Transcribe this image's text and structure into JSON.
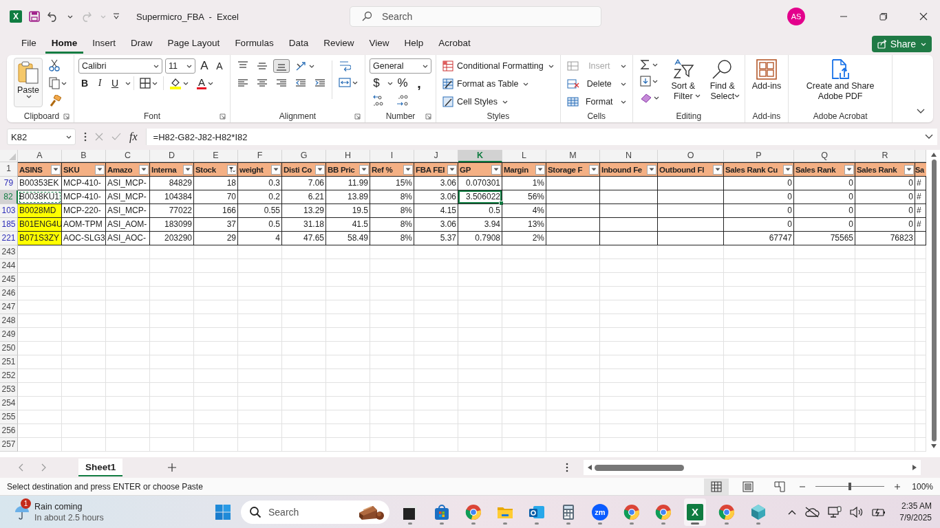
{
  "title_bar": {
    "app_letter": "X",
    "title": "Supermicro_FBA  -  Excel",
    "search_placeholder": "Search",
    "avatar": "AS"
  },
  "menu_tabs": [
    {
      "label": "File",
      "selected": false
    },
    {
      "label": "Home",
      "selected": true
    },
    {
      "label": "Insert",
      "selected": false
    },
    {
      "label": "Draw",
      "selected": false
    },
    {
      "label": "Page Layout",
      "selected": false
    },
    {
      "label": "Formulas",
      "selected": false
    },
    {
      "label": "Data",
      "selected": false
    },
    {
      "label": "Review",
      "selected": false
    },
    {
      "label": "View",
      "selected": false
    },
    {
      "label": "Help",
      "selected": false
    },
    {
      "label": "Acrobat",
      "selected": false
    }
  ],
  "share_button": "Share",
  "ribbon": {
    "clipboard": {
      "label": "Clipboard",
      "paste": "Paste"
    },
    "font": {
      "label": "Font",
      "font_name": "Calibri",
      "font_size": "11",
      "grow": "A",
      "shrink": "A",
      "styles": [
        "B",
        "I",
        "U"
      ],
      "font_color": "A"
    },
    "alignment": {
      "label": "Alignment",
      "bottom_align_selected": true
    },
    "number": {
      "label": "Number",
      "format": "General",
      "symbols": [
        "$",
        "%",
        ","
      ]
    },
    "styles": {
      "label": "Styles",
      "buttons": [
        "Conditional Formatting",
        "Format as Table",
        "Cell Styles"
      ]
    },
    "cells": {
      "label": "Cells",
      "buttons": [
        {
          "label": "Insert",
          "disabled": true
        },
        {
          "label": "Delete",
          "disabled": false
        },
        {
          "label": "Format",
          "disabled": false
        }
      ]
    },
    "editing": {
      "label": "Editing",
      "buttons": [
        "Sort & Filter",
        "Find & Select"
      ]
    },
    "addins": {
      "label": "Add-ins",
      "button": "Add-ins"
    },
    "acrobat": {
      "label": "Adobe Acrobat",
      "button": "Create and Share Adobe PDF"
    }
  },
  "formula_bar": {
    "name_box": "K82",
    "fx": "fx",
    "formula": "=H82-G82-J82-H82*I82"
  },
  "grid": {
    "columns": [
      {
        "letter": "A",
        "selected": false
      },
      {
        "letter": "B",
        "selected": false
      },
      {
        "letter": "C",
        "selected": false
      },
      {
        "letter": "D",
        "selected": false
      },
      {
        "letter": "E",
        "selected": false
      },
      {
        "letter": "F",
        "selected": false
      },
      {
        "letter": "G",
        "selected": false
      },
      {
        "letter": "H",
        "selected": false
      },
      {
        "letter": "I",
        "selected": false
      },
      {
        "letter": "J",
        "selected": false
      },
      {
        "letter": "K",
        "selected": true
      },
      {
        "letter": "L",
        "selected": false
      },
      {
        "letter": "M",
        "selected": false
      },
      {
        "letter": "N",
        "selected": false
      },
      {
        "letter": "O",
        "selected": false
      },
      {
        "letter": "P",
        "selected": false
      },
      {
        "letter": "Q",
        "selected": false
      },
      {
        "letter": "R",
        "selected": false
      },
      {
        "selected": false
      }
    ],
    "header_row": {
      "number": "1",
      "cells": [
        {
          "text": "ASINS",
          "filtered": false
        },
        {
          "text": "SKU",
          "filtered": false
        },
        {
          "text": "Amazo",
          "filtered": false
        },
        {
          "text": "Interna",
          "filtered": false
        },
        {
          "text": "Stock",
          "filtered": true
        },
        {
          "text": "weight",
          "filtered": false
        },
        {
          "text": "Disti Co",
          "filtered": false
        },
        {
          "text": "BB Pric",
          "filtered": false
        },
        {
          "text": "Ref %",
          "filtered": false
        },
        {
          "text": "FBA FEI",
          "filtered": false
        },
        {
          "text": "GP",
          "filtered": false
        },
        {
          "text": "Margin",
          "filtered": false
        },
        {
          "text": "Storage F",
          "filtered": false
        },
        {
          "text": "Inbound Fe",
          "filtered": false
        },
        {
          "text": "Outbound Fl",
          "filtered": false
        },
        {
          "text": "Sales Rank Cu",
          "filtered": false
        },
        {
          "text": "Sales Rank",
          "filtered": false
        },
        {
          "text": "Sales Rank",
          "filtered": false
        },
        {
          "text": "Sa"
        }
      ]
    },
    "rows": [
      {
        "number": "79",
        "selected": false,
        "first_cell_highlighted": false,
        "first_cell_copied": false,
        "cells": [
          "B00353EK",
          "MCP-410-",
          "ASI_MCP-",
          "84829",
          "18",
          "0.3",
          "7.06",
          "11.99",
          "15%",
          "3.06",
          "0.070301",
          "1%",
          null,
          null,
          null,
          "0",
          "0",
          "0",
          "#"
        ]
      },
      {
        "number": "82",
        "selected": true,
        "first_cell_highlighted": false,
        "first_cell_copied": true,
        "cells": [
          "B0038KU1",
          "MCP-410-",
          "ASI_MCP-",
          "104384",
          "70",
          "0.2",
          "6.21",
          "13.89",
          "8%",
          "3.06",
          "3.506022",
          "56%",
          null,
          null,
          null,
          "0",
          "0",
          "0",
          "#"
        ]
      },
      {
        "number": "103",
        "selected": false,
        "first_cell_highlighted": true,
        "first_cell_copied": false,
        "cells": [
          "B0028MD",
          "MCP-220-",
          "ASI_MCP-",
          "77022",
          "166",
          "0.55",
          "13.29",
          "19.5",
          "8%",
          "4.15",
          "0.5",
          "4%",
          null,
          null,
          null,
          "0",
          "0",
          "0",
          "#"
        ]
      },
      {
        "number": "185",
        "selected": false,
        "first_cell_highlighted": true,
        "first_cell_copied": false,
        "cells": [
          "B01ENG4U",
          "AOM-TPM",
          "ASI_AOM-",
          "183099",
          "37",
          "0.5",
          "31.18",
          "41.5",
          "8%",
          "3.06",
          "3.94",
          "13%",
          null,
          null,
          null,
          "0",
          "0",
          "0",
          "#"
        ]
      },
      {
        "number": "221",
        "selected": false,
        "first_cell_highlighted": true,
        "first_cell_copied": false,
        "cells": [
          "B071S3ZY",
          "AOC-SLG3",
          "ASI_AOC-",
          "203290",
          "29",
          "4",
          "47.65",
          "58.49",
          "8%",
          "5.37",
          "0.7908",
          "2%",
          null,
          null,
          null,
          "67747",
          "75565",
          "76823",
          null
        ]
      }
    ],
    "empty_rows": [
      "243",
      "244",
      "245",
      "246",
      "247",
      "248",
      "249",
      "250",
      "251",
      "252",
      "253",
      "254",
      "255",
      "256",
      "257"
    ]
  },
  "sheet_tabs": [
    {
      "label": "Sheet1",
      "selected": true
    }
  ],
  "status_bar": {
    "message": "Select destination and press ENTER or choose Paste",
    "views": [
      {
        "selected": true
      },
      {
        "selected": false
      },
      {
        "selected": false
      }
    ],
    "zoom": {
      "level": 0.5,
      "reading": "100%"
    }
  },
  "taskbar": {
    "weather": {
      "badge": "1",
      "title": "Rain coming",
      "subtitle": "In about 2.5 hours"
    },
    "search_placeholder": "Search",
    "apps": [
      {
        "kind": "desktop",
        "active": false
      },
      {
        "kind": "store",
        "active": false
      },
      {
        "kind": "chrome",
        "active": false
      },
      {
        "kind": "folder",
        "active": false
      },
      {
        "kind": "mail",
        "active": false
      },
      {
        "kind": "calculator",
        "active": false
      },
      {
        "kind": "zoom",
        "label": "zm",
        "active": false
      },
      {
        "kind": "chrome",
        "active": false
      },
      {
        "kind": "chrome",
        "active": false
      },
      {
        "kind": "spreadsheet",
        "label": "X",
        "active": true
      },
      {
        "kind": "chrome",
        "active": false
      },
      {
        "kind": "gem",
        "active": false
      }
    ],
    "time": "2:35 AM",
    "date": "7/9/2025"
  }
}
